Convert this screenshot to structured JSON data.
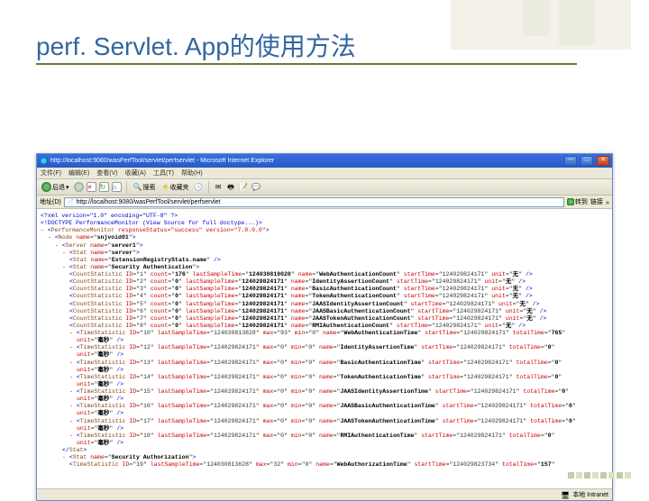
{
  "slide": {
    "title": "perf. Servlet. App的使用方法"
  },
  "ie": {
    "title": "http://localhost:9080/wasPerfTool/servlet/perfservlet - Microsoft Internet Explorer",
    "menu": {
      "file": "文件(F)",
      "edit": "编辑(E)",
      "view": "查看(V)",
      "favorites": "收藏(A)",
      "tools": "工具(T)",
      "help": "帮助(H)"
    },
    "toolbar": {
      "back": "后退",
      "search_label": "搜索",
      "favorites_label": "收藏夹"
    },
    "address": {
      "label": "地址(D)",
      "value": "http://localhost:9080/wasPerfTool/servlet/perfservlet",
      "go": "转到",
      "links": "链接"
    },
    "status": {
      "zone": "本地 Intranet"
    }
  },
  "xml": {
    "decl": "<?xml version=\"1.0\" encoding=\"UTF-8\" ?>",
    "doctype": "<!DOCTYPE PerformanceMonitor (View Source for full doctype...)>",
    "root": "PerformanceMonitor",
    "root_attrs": "responseStatus=\"success\" version=\"7.0.0.0\"",
    "node": "snjvoid01",
    "server": "server1",
    "stat_top": "server",
    "stat_sec": "Security Authentication",
    "substat": "ExtensionRegistryStats.name",
    "cs": [
      {
        "id": "1",
        "count": "176",
        "lst": "124030810020",
        "name": "WebAuthenticationCount",
        "start": "124029824171",
        "unit": "无"
      },
      {
        "id": "2",
        "count": "0",
        "lst": "124029824171",
        "name": "IdentityAssertionCount",
        "start": "124029824171",
        "unit": "无"
      },
      {
        "id": "3",
        "count": "0",
        "lst": "124029824171",
        "name": "BasicAuthenticationCount",
        "start": "124029824171",
        "unit": "无"
      },
      {
        "id": "4",
        "count": "0",
        "lst": "124029824171",
        "name": "TokenAuthenticationCount",
        "start": "124029824171",
        "unit": "无"
      },
      {
        "id": "5",
        "count": "0",
        "lst": "124029824171",
        "name": "JAASIdentityAssertionCount",
        "start": "124029824171",
        "unit": "无"
      },
      {
        "id": "6",
        "count": "0",
        "lst": "124029824171",
        "name": "JAASBasicAuthenticationCount",
        "start": "124029824171",
        "unit": "无"
      },
      {
        "id": "7",
        "count": "0",
        "lst": "124029824171",
        "name": "JAASTokenAuthenticationCount",
        "start": "124029824171",
        "unit": "无"
      },
      {
        "id": "8",
        "count": "0",
        "lst": "124029824171",
        "name": "RMIAuthenticationCount",
        "start": "124029824171",
        "unit": "无"
      }
    ],
    "ts_lead": {
      "id": "10",
      "lst": "124030813828",
      "max": "93",
      "min": "0",
      "name": "WebAuthenticationTime",
      "start": "124029824171",
      "total": "765",
      "unit": "毫秒"
    },
    "ts": [
      {
        "id": "12",
        "lst": "124029824171",
        "name": "IdentityAssertionTime",
        "start": "124029824171",
        "total": "0",
        "unit": "毫秒"
      },
      {
        "id": "13",
        "lst": "124029824171",
        "name": "BasicAuthenticationTime",
        "start": "124029824171",
        "total": "0",
        "unit": "毫秒"
      },
      {
        "id": "14",
        "lst": "124029824171",
        "name": "TokenAuthenticationTime",
        "start": "124029824171",
        "total": "0",
        "unit": "毫秒"
      },
      {
        "id": "15",
        "lst": "124029824171",
        "name": "JAASIdentityAssertionTime",
        "start": "124029824171",
        "total": "0",
        "unit": "毫秒"
      },
      {
        "id": "16",
        "lst": "124029824171",
        "name": "JAASBasicAuthenticationTime",
        "start": "124029824171",
        "total": "0",
        "unit": "毫秒"
      },
      {
        "id": "17",
        "lst": "124029824171",
        "name": "JAASTokenAuthenticationTime",
        "start": "124029824171",
        "total": "0",
        "unit": "毫秒"
      },
      {
        "id": "18",
        "lst": "124029824171",
        "name": "RMIAuthenticationTime",
        "start": "124029824171",
        "total": "0",
        "unit": "毫秒"
      }
    ],
    "stat2": "Security Authorization",
    "ts2": {
      "id": "19",
      "lst": "124030813828",
      "max": "32",
      "min": "0",
      "name": "WebAuthorizationTime",
      "start": "124029823734",
      "total": "157"
    }
  }
}
